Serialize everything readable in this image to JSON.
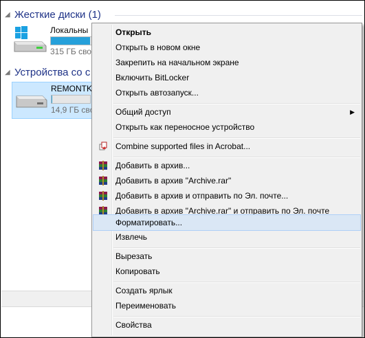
{
  "groups": [
    {
      "title": "Жесткие диски (1)"
    },
    {
      "title": "Устройства со с"
    }
  ],
  "drives": [
    {
      "name": "Локальны",
      "info": "315 ГБ своб",
      "fill": 0.95
    },
    {
      "name": "REMONTKA",
      "info": "14,9 ГБ своб",
      "fill": 0.02
    }
  ],
  "menu": {
    "items": [
      {
        "label": "Открыть"
      },
      {
        "label": "Открыть в новом окне"
      },
      {
        "label": "Закрепить на начальном экране"
      },
      {
        "label": "Включить BitLocker"
      },
      {
        "label": "Открыть автозапуск..."
      },
      {
        "label": "Общий доступ"
      },
      {
        "label": "Открыть как переносное устройство"
      },
      {
        "label": "Combine supported files in Acrobat..."
      },
      {
        "label": "Добавить в архив..."
      },
      {
        "label": "Добавить в архив \"Archive.rar\""
      },
      {
        "label": "Добавить в архив и отправить по Эл. почте..."
      },
      {
        "label": "Добавить в архив \"Archive.rar\" и отправить по Эл. почте"
      },
      {
        "label": "Форматировать..."
      },
      {
        "label": "Извлечь"
      },
      {
        "label": "Вырезать"
      },
      {
        "label": "Копировать"
      },
      {
        "label": "Создать ярлык"
      },
      {
        "label": "Переименовать"
      },
      {
        "label": "Свойства"
      }
    ]
  },
  "colors": {
    "group_header": "#1e3287",
    "selection": "#cce8ff",
    "menu_hover": "#dae7f5",
    "capacity_fill": "#26a0da"
  },
  "icons": [
    "windows-logo-icon",
    "hard-drive-icon",
    "usb-drive-icon",
    "submenu-arrow-icon",
    "acrobat-icon",
    "winrar-icon"
  ]
}
